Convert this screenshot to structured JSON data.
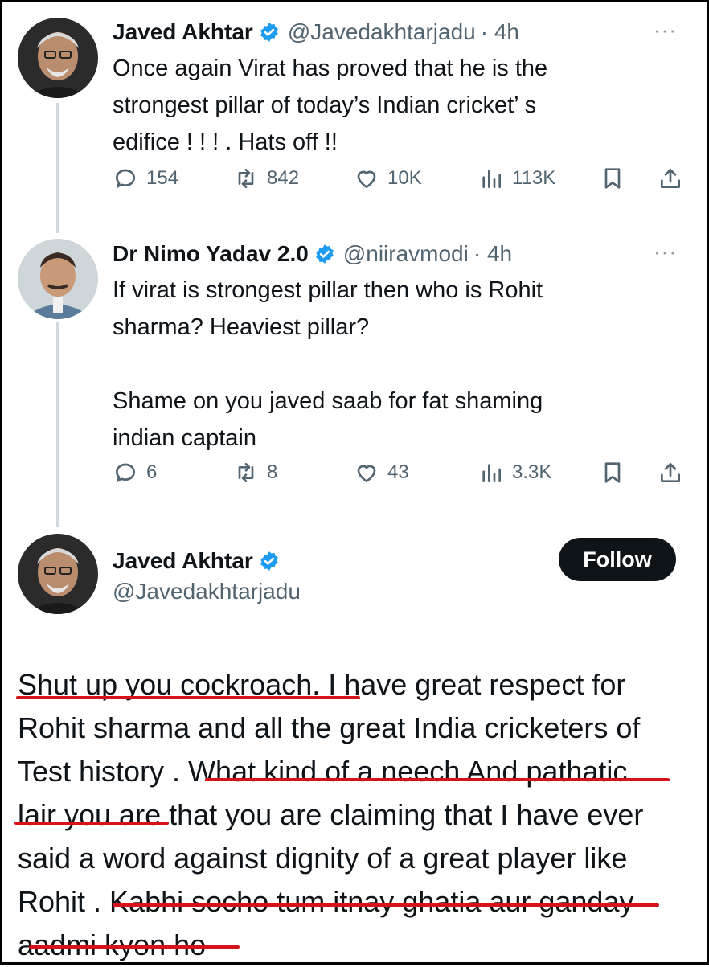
{
  "tweet1": {
    "name": "Javed Akhtar",
    "handle": "@Javedakhtarjadu",
    "time": "· 4h",
    "more": "···",
    "lines": [
      "Once again Virat has proved that he is the",
      "strongest pillar of today’s Indian cricket’ s",
      "edifice ! ! ! . Hats off  !!"
    ],
    "stats": {
      "replies": "154",
      "reposts": "842",
      "likes": "10K",
      "views": "113K"
    }
  },
  "tweet2": {
    "name": "Dr Nimo Yadav 2.0",
    "handle": "@niiravmodi",
    "time": "· 4h",
    "more": "···",
    "lines": [
      "If virat is strongest pillar then who is Rohit",
      "sharma? Heaviest pillar?",
      "",
      "Shame on you javed saab for fat shaming",
      "indian captain"
    ],
    "stats": {
      "replies": "6",
      "reposts": "8",
      "likes": "43",
      "views": "3.3K"
    }
  },
  "reply": {
    "name": "Javed Akhtar",
    "handle": "@Javedakhtarjadu",
    "follow_label": "Follow",
    "lines": [
      "Shut up you cockroach. I have great respect for",
      "Rohit sharma and all the great India cricketers of",
      "Test history . What kind of a neech And pathatic",
      "lair you are that you are claiming that I have ever",
      "said a word against dignity of a great player like",
      "Rohit . Kabhi socho tum itnay ghatia aur ganday",
      "aadmi kyon ho"
    ]
  },
  "icons": {
    "verified": "verified-badge-icon",
    "reply": "reply-bubble-icon",
    "repost": "repost-icon",
    "like": "heart-icon",
    "views": "views-bar-icon",
    "bookmark": "bookmark-icon",
    "share": "share-icon"
  },
  "colors": {
    "verified": "#1d9bf0",
    "underline": "#d6131b",
    "muted": "#536471",
    "text": "#0f1419"
  }
}
